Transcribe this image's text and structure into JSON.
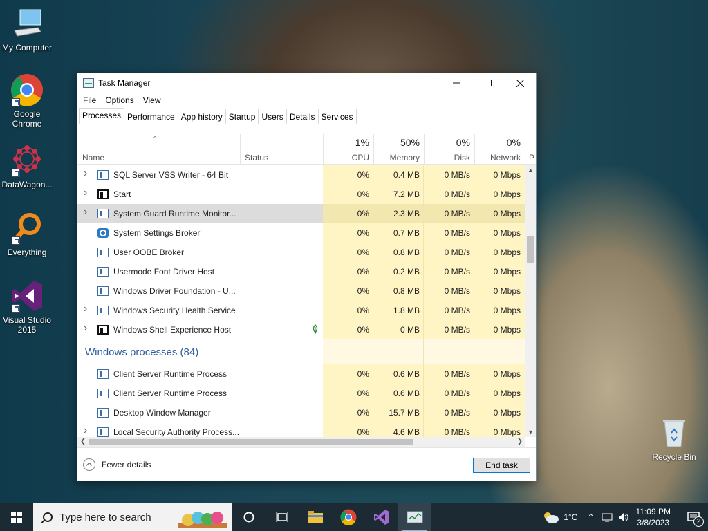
{
  "desktop": {
    "icons": [
      {
        "label": "My Computer"
      },
      {
        "label": "Google Chrome"
      },
      {
        "label": "DataWagon..."
      },
      {
        "label": "Everything"
      },
      {
        "label": "Visual Studio 2015"
      },
      {
        "label": "Recycle Bin"
      }
    ]
  },
  "window": {
    "title": "Task Manager",
    "menu": [
      "File",
      "Options",
      "View"
    ],
    "tabs": [
      "Processes",
      "Performance",
      "App history",
      "Startup",
      "Users",
      "Details",
      "Services"
    ],
    "columns": {
      "name": "Name",
      "status": "Status",
      "cpu": {
        "pct": "1%",
        "label": "CPU"
      },
      "memory": {
        "pct": "50%",
        "label": "Memory"
      },
      "disk": {
        "pct": "0%",
        "label": "Disk"
      },
      "network": {
        "pct": "0%",
        "label": "Network"
      },
      "power_partial": "P"
    },
    "rows": [
      {
        "name": "SQL Server VSS Writer - 64 Bit",
        "cpu": "0%",
        "memory": "0.4 MB",
        "disk": "0 MB/s",
        "network": "0 Mbps"
      },
      {
        "name": "Start",
        "cpu": "0%",
        "memory": "7.2 MB",
        "disk": "0 MB/s",
        "network": "0 Mbps"
      },
      {
        "name": "System Guard Runtime Monitor...",
        "cpu": "0%",
        "memory": "2.3 MB",
        "disk": "0 MB/s",
        "network": "0 Mbps"
      },
      {
        "name": "System Settings Broker",
        "cpu": "0%",
        "memory": "0.7 MB",
        "disk": "0 MB/s",
        "network": "0 Mbps"
      },
      {
        "name": "User OOBE Broker",
        "cpu": "0%",
        "memory": "0.8 MB",
        "disk": "0 MB/s",
        "network": "0 Mbps"
      },
      {
        "name": "Usermode Font Driver Host",
        "cpu": "0%",
        "memory": "0.2 MB",
        "disk": "0 MB/s",
        "network": "0 Mbps"
      },
      {
        "name": "Windows Driver Foundation - U...",
        "cpu": "0%",
        "memory": "0.8 MB",
        "disk": "0 MB/s",
        "network": "0 Mbps"
      },
      {
        "name": "Windows Security Health Service",
        "cpu": "0%",
        "memory": "1.8 MB",
        "disk": "0 MB/s",
        "network": "0 Mbps"
      },
      {
        "name": "Windows Shell Experience Host",
        "cpu": "0%",
        "memory": "0 MB",
        "disk": "0 MB/s",
        "network": "0 Mbps"
      }
    ],
    "group": {
      "title": "Windows processes (84)"
    },
    "rows2": [
      {
        "name": "Client Server Runtime Process",
        "cpu": "0%",
        "memory": "0.6 MB",
        "disk": "0 MB/s",
        "network": "0 Mbps"
      },
      {
        "name": "Client Server Runtime Process",
        "cpu": "0%",
        "memory": "0.6 MB",
        "disk": "0 MB/s",
        "network": "0 Mbps"
      },
      {
        "name": "Desktop Window Manager",
        "cpu": "0%",
        "memory": "15.7 MB",
        "disk": "0 MB/s",
        "network": "0 Mbps"
      },
      {
        "name": "Local Security Authority Process...",
        "cpu": "0%",
        "memory": "4.6 MB",
        "disk": "0 MB/s",
        "network": "0 Mbps"
      }
    ],
    "footer": {
      "fewer_details": "Fewer details",
      "end_task": "End task"
    }
  },
  "taskbar": {
    "search_placeholder": "Type here to search",
    "weather": "1°C",
    "time": "11:09 PM",
    "date": "3/8/2023",
    "notification_count": "2"
  }
}
